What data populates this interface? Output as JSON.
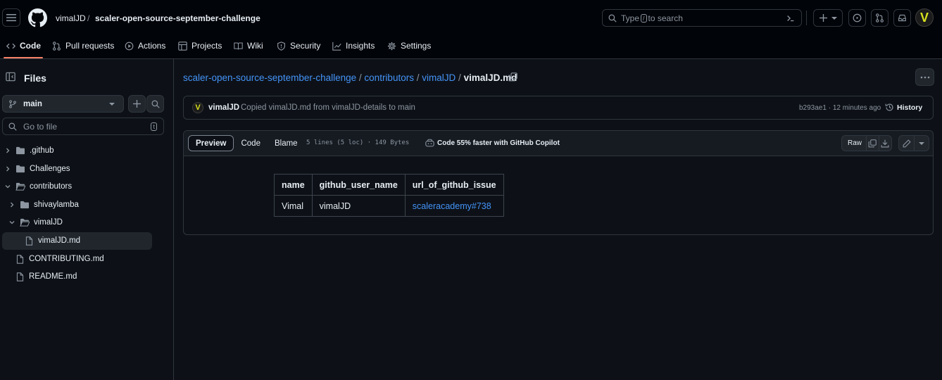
{
  "header": {
    "owner": "vimalJD",
    "separator": "/",
    "repo": "scaler-open-source-september-challenge",
    "search_pre": "Type",
    "search_key": "/",
    "search_post": "to search",
    "avatar_letter": "V"
  },
  "tabs": [
    {
      "label": "Code",
      "icon": "code-icon"
    },
    {
      "label": "Pull requests",
      "icon": "pull-request-icon"
    },
    {
      "label": "Actions",
      "icon": "play-icon"
    },
    {
      "label": "Projects",
      "icon": "table-icon"
    },
    {
      "label": "Wiki",
      "icon": "book-icon"
    },
    {
      "label": "Security",
      "icon": "shield-icon"
    },
    {
      "label": "Insights",
      "icon": "graph-icon"
    },
    {
      "label": "Settings",
      "icon": "gear-icon"
    }
  ],
  "sidebar": {
    "title": "Files",
    "branch": "main",
    "goto_placeholder": "Go to file",
    "goto_key": "t",
    "tree": [
      {
        "label": ".github",
        "type": "folder",
        "expanded": false
      },
      {
        "label": "Challenges",
        "type": "folder",
        "expanded": false
      },
      {
        "label": "contributors",
        "type": "folder",
        "expanded": true
      },
      {
        "label": "shivaylamba",
        "type": "folder",
        "expanded": false
      },
      {
        "label": "vimalJD",
        "type": "folder",
        "expanded": true
      },
      {
        "label": "vimalJD.md",
        "type": "file",
        "selected": true
      },
      {
        "label": "CONTRIBUTING.md",
        "type": "file"
      },
      {
        "label": "README.md",
        "type": "file"
      }
    ]
  },
  "breadcrumb": {
    "repo": "scaler-open-source-september-challenge",
    "dir1": "contributors",
    "dir2": "vimalJD",
    "file": "vimalJD.md",
    "sep": "/"
  },
  "commit": {
    "author": "vimalJD",
    "message": "Copied vimalJD.md from vimalJD-details to main",
    "sha_time": "b293ae1 · 12 minutes ago",
    "history_label": "History"
  },
  "file_header": {
    "tabs": [
      "Preview",
      "Code",
      "Blame"
    ],
    "meta": "5 lines (5 loc) · 149 Bytes",
    "copilot": "Code 55% faster with GitHub Copilot",
    "raw": "Raw"
  },
  "table": {
    "headers": [
      "name",
      "github_user_name",
      "url_of_github_issue"
    ],
    "row": [
      "Vimal",
      "vimalJD",
      "scaleracademy#738"
    ]
  },
  "colors": {
    "accent_link": "#4493f8",
    "tab_underline": "#f78166",
    "background": "#0d1117"
  }
}
